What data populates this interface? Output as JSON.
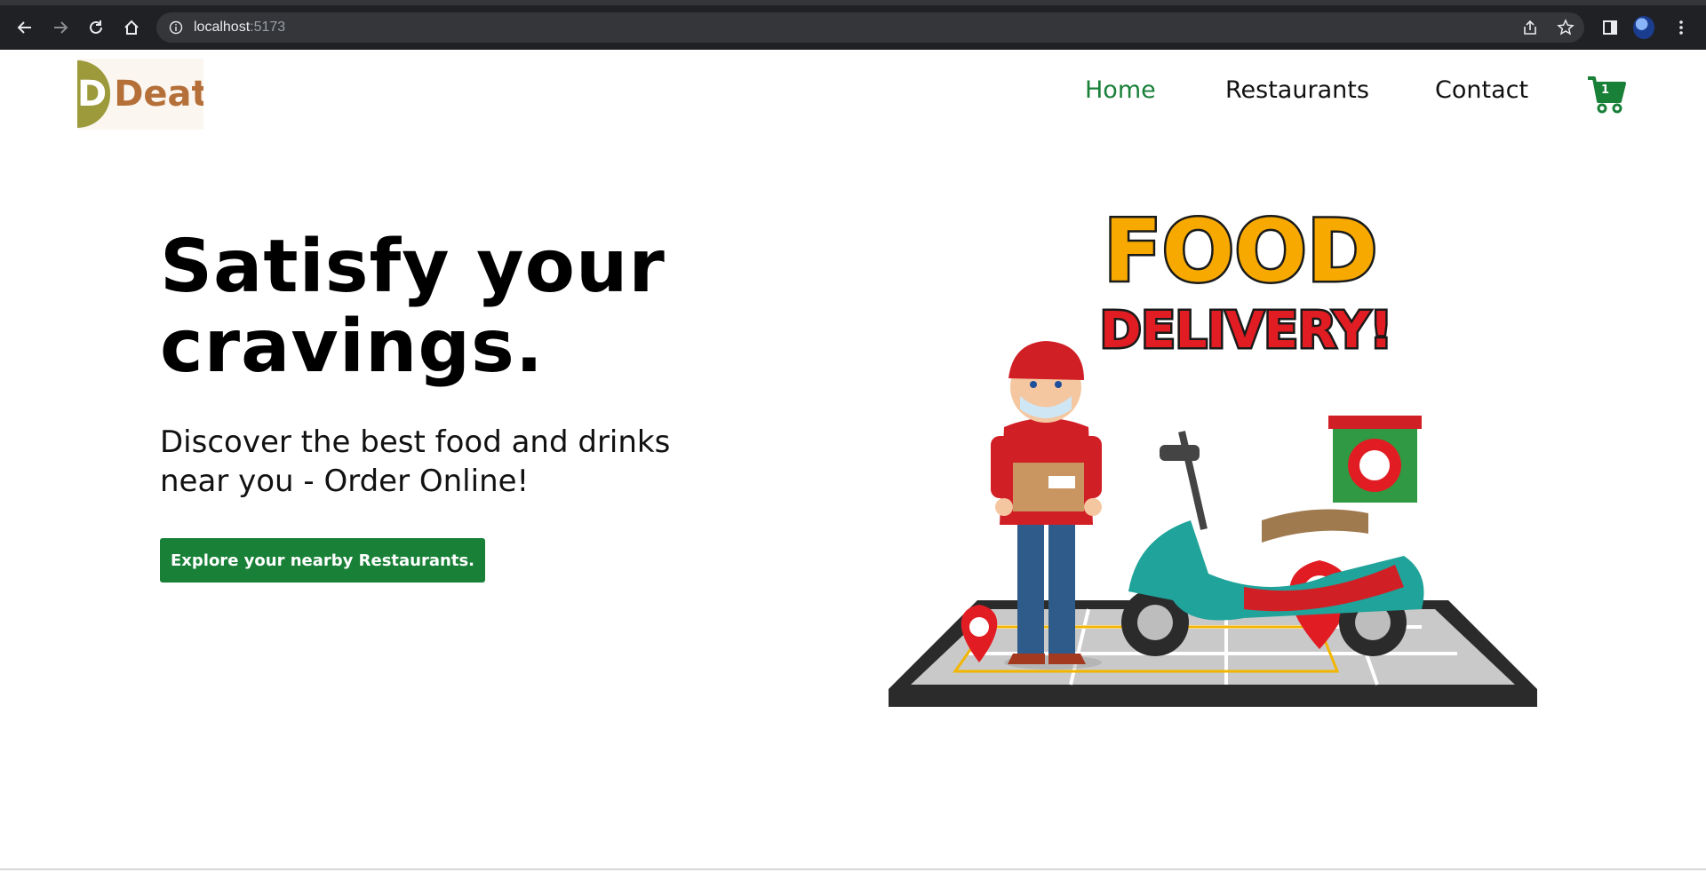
{
  "browser": {
    "url_host": "localhost",
    "url_port": ":5173",
    "icons": [
      "back-icon",
      "forward-icon",
      "reload-icon",
      "home-icon",
      "info-icon",
      "share-icon",
      "star-icon",
      "sidepanel-icon",
      "avatar",
      "menu-icon"
    ]
  },
  "header": {
    "logo_mark": "D",
    "logo_word": "Deat",
    "nav": [
      {
        "label": "Home",
        "active": true
      },
      {
        "label": "Restaurants",
        "active": false
      },
      {
        "label": "Contact",
        "active": false
      }
    ],
    "cart_count": "1",
    "accent_color": "#198038"
  },
  "hero": {
    "title_line1": "Satisfy your",
    "title_line2": "cravings.",
    "subtitle_line1": "Discover the best food and drinks",
    "subtitle_line2": "near you - Order Online!",
    "cta_label": "Explore your nearby Restaurants.",
    "illustration": {
      "headline_word1": "FOOD",
      "headline_word2": "DELIVERY!"
    }
  }
}
